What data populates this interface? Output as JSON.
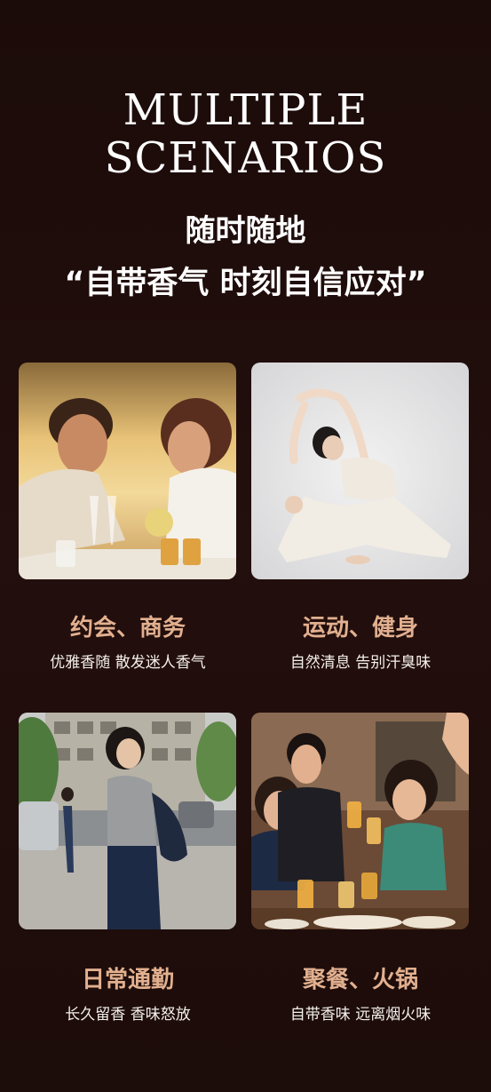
{
  "header": {
    "title_line1": "MULTIPLE",
    "title_line2": "SCENARIOS",
    "subtitle_line1": "随时随地",
    "subtitle_line2": "“自带香气 时刻自信应对”"
  },
  "scenarios": [
    {
      "title": "约会、商务",
      "description": "优雅香随 散发迷人香气",
      "image": "dinner-date-photo"
    },
    {
      "title": "运动、健身",
      "description": "自然清息 告别汗臭味",
      "image": "yoga-pose-photo"
    },
    {
      "title": "日常通勤",
      "description": "长久留香 香味怒放",
      "image": "street-commute-photo"
    },
    {
      "title": "聚餐、火锅",
      "description": "自带香味 远离烟火味",
      "image": "friends-toast-photo"
    }
  ],
  "colors": {
    "background": "#1f0e0c",
    "accent_title": "#e2b08f",
    "text": "#ffffff"
  }
}
